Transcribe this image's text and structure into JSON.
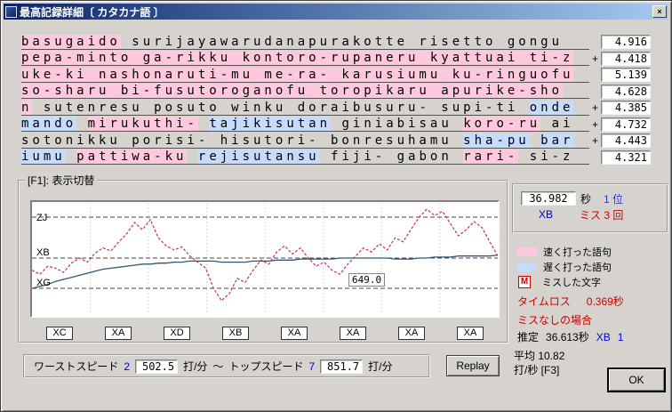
{
  "window": {
    "title": "最高記録詳細〔 カタカナ語 〕",
    "close_label": "×"
  },
  "plus_symbol": "+",
  "lines": [
    {
      "plus": false,
      "time": "4.916",
      "segments": [
        {
          "t": "basugaido",
          "h": "fast"
        },
        {
          "t": " surijayawarudanapurakotte risetto gongu",
          "h": "none"
        }
      ]
    },
    {
      "plus": true,
      "time": "4.418",
      "segments": [
        {
          "t": "pepa-minto ga-rikku kontoro-rupaneru kyattuai ti-z",
          "h": "fast"
        }
      ]
    },
    {
      "plus": false,
      "time": "5.139",
      "segments": [
        {
          "t": "uke-ki nashonaruti-mu me-ra- karusiumu ku-ringuofu",
          "h": "fast"
        }
      ]
    },
    {
      "plus": false,
      "time": "4.628",
      "segments": [
        {
          "t": "so-sharu bi-fusutoroganofu toropikaru apurike-sho",
          "h": "fast"
        }
      ]
    },
    {
      "plus": true,
      "time": "4.385",
      "segments": [
        {
          "t": "n",
          "h": "fast"
        },
        {
          "t": " sutenresu posuto winku doraibusuru- supi-ti ",
          "h": "none"
        },
        {
          "t": "onde",
          "h": "slow"
        }
      ]
    },
    {
      "plus": true,
      "time": "4.732",
      "segments": [
        {
          "t": "mando",
          "h": "slow"
        },
        {
          "t": " ",
          "h": "none"
        },
        {
          "t": "mirukuthi-",
          "h": "fast"
        },
        {
          "t": " ",
          "h": "none"
        },
        {
          "t": "tajikisutan",
          "h": "slow"
        },
        {
          "t": " giniabisau ",
          "h": "none"
        },
        {
          "t": "koro-ru",
          "h": "fast"
        },
        {
          "t": " ai",
          "h": "none"
        }
      ]
    },
    {
      "plus": true,
      "time": "4.443",
      "segments": [
        {
          "t": "sotonikku porisi- hisutori- bonresuhamu ",
          "h": "none"
        },
        {
          "t": "sha-pu",
          "h": "slow"
        },
        {
          "t": " ",
          "h": "none"
        },
        {
          "t": "bar",
          "h": "slow"
        }
      ]
    },
    {
      "plus": false,
      "time": "4.321",
      "segments": [
        {
          "t": "iumu",
          "h": "slow"
        },
        {
          "t": " ",
          "h": "none"
        },
        {
          "t": "pattiwa-ku",
          "h": "fast"
        },
        {
          "t": " ",
          "h": "none"
        },
        {
          "t": "rejisutansu",
          "h": "slow"
        },
        {
          "t": " fiji- gabon ",
          "h": "none"
        },
        {
          "t": "rari-",
          "h": "fast"
        },
        {
          "t": " si-z",
          "h": "none"
        }
      ]
    }
  ],
  "graph": {
    "group_label": "[F1]: 表示切替",
    "y_labels": [
      "ZJ",
      "XB",
      "XG"
    ],
    "marker_value": "649.0",
    "x_boxes": [
      "XC",
      "XA",
      "XD",
      "XB",
      "XA",
      "XA",
      "XA",
      "XA"
    ],
    "series": {
      "instant": [
        38,
        34,
        42,
        40,
        36,
        45,
        50,
        46,
        55,
        60,
        57,
        66,
        74,
        85,
        78,
        88,
        70,
        62,
        58,
        61,
        52,
        46,
        40,
        20,
        8,
        15,
        30,
        26,
        38,
        48,
        44,
        56,
        62,
        54,
        60,
        50,
        42,
        46,
        38,
        34,
        44,
        52,
        60,
        56,
        64,
        58,
        70,
        66,
        78,
        90,
        98,
        92,
        96,
        84,
        72,
        78,
        86,
        80,
        66,
        52
      ],
      "average": [
        20,
        22,
        24,
        27,
        29,
        31,
        33,
        35,
        37,
        39,
        40,
        41,
        42,
        43,
        44,
        44,
        45,
        45,
        46,
        46,
        47,
        47,
        47,
        47,
        46,
        46,
        46,
        46,
        47,
        47,
        47,
        48,
        48,
        48,
        49,
        49,
        49,
        49,
        49,
        50,
        50,
        50,
        50,
        50,
        50,
        50,
        49,
        49,
        49,
        50,
        50,
        51,
        51,
        51,
        52,
        52,
        52,
        52,
        52,
        53
      ]
    }
  },
  "speedbar": {
    "worst_label": "ワーストスピード",
    "worst_index": "2",
    "worst_value": "502.5",
    "unit": "打/分",
    "tilde": "～",
    "top_label": "トップスピード",
    "top_index": "7",
    "top_value": "851.7",
    "replay_label": "Replay"
  },
  "result": {
    "time": "36.982",
    "time_unit": "秒",
    "rank_place": "1 位",
    "grade": "XB",
    "miss": "ミス 3 回",
    "legend": [
      {
        "label": "速く打った語句",
        "type": "fast"
      },
      {
        "label": "遅く打った語句",
        "type": "slow"
      },
      {
        "label": "ミスした文字",
        "type": "miss",
        "mark": "M"
      }
    ],
    "timeloss_label": "タイムロス",
    "timeloss_value": "0.369秒",
    "nomiss_label": "ミスなしの場合",
    "estimate_label": "推定",
    "estimate_value": "36.613秒",
    "estimate_grade": "XB",
    "estimate_rank": "1",
    "average_line1": "平均 10.82",
    "average_line2": "打/秒 [F3]",
    "ok_label": "OK"
  }
}
